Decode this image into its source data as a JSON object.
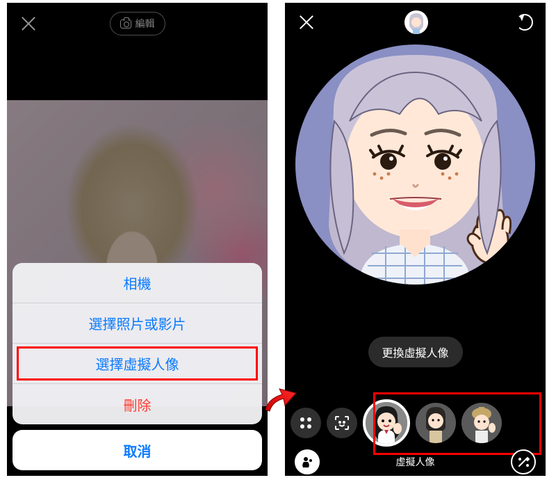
{
  "left": {
    "edit_label": "編輯",
    "sheet": {
      "camera": "相機",
      "photo_video": "選擇照片或影片",
      "avatar": "選擇虛擬人像",
      "delete": "刪除"
    },
    "cancel": "取消"
  },
  "right": {
    "change_avatar": "更換虛擬人像",
    "bottom_label": "虛擬人像"
  },
  "colors": {
    "ios_blue": "#0a7aff",
    "ios_red": "#ff3b30",
    "highlight": "#ff0000"
  }
}
